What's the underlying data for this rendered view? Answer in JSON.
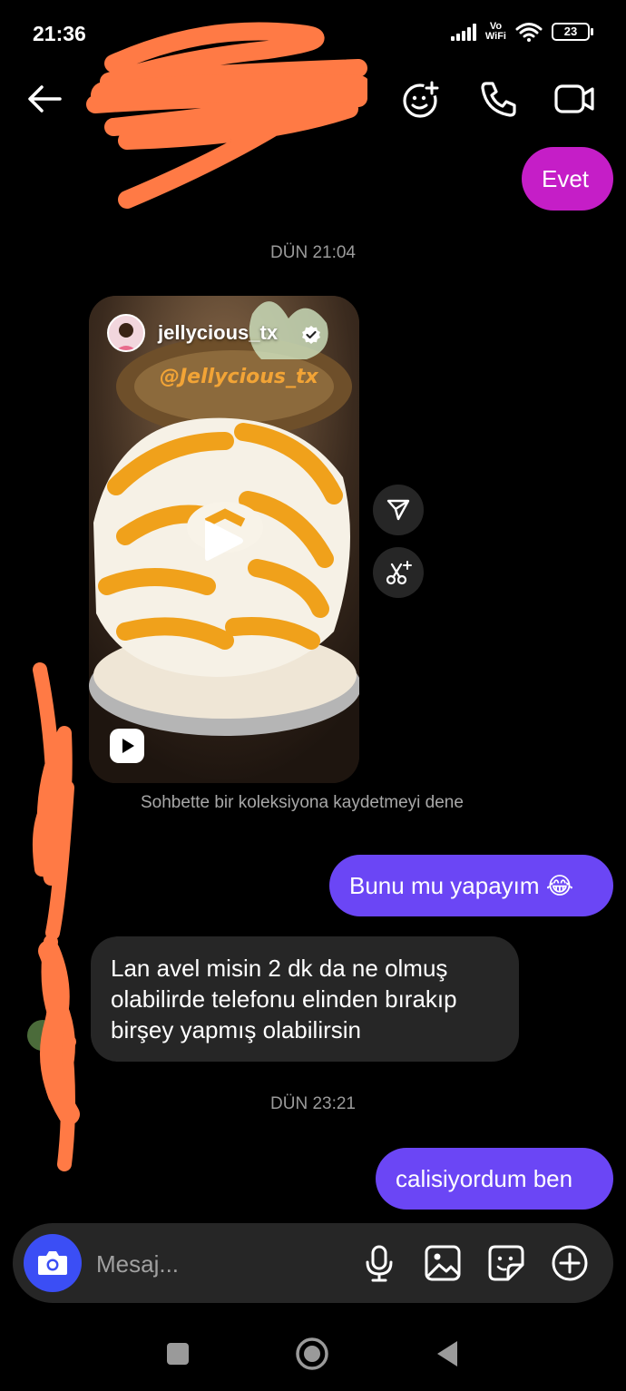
{
  "status_bar": {
    "time": "21:36",
    "network_label_top": "Vo",
    "network_label_bottom": "WiFi",
    "battery": "23"
  },
  "header": {
    "back_icon": "arrow-left-icon",
    "actions": [
      "add-effect-icon",
      "phone-icon",
      "video-camera-icon"
    ]
  },
  "messages": {
    "sent_evet": "Evet",
    "timestamp_1": "DÜN 21:04",
    "reel": {
      "username": "jellycious_tx",
      "watermark": "@Jellycious_tx"
    },
    "save_hint": "Sohbette bir koleksiyona kaydetmeyi dene",
    "sent_bunu": "Bunu mu yapayım 😂",
    "received_1": "Lan avel misin 2 dk da ne olmuş olabilirde telefonu elinden bırakıp birşey yapmış olabilirsin",
    "timestamp_2": "DÜN 23:21",
    "sent_calisiyordum": "calisiyordum ben"
  },
  "composer": {
    "placeholder": "Mesaj..."
  },
  "colors": {
    "background": "#000000",
    "sent_bubble": "#6b46f5",
    "sent_bubble_alt": "#c51ec7",
    "received_bubble": "#262626",
    "camera_button": "#3b4ef5",
    "redaction": "#ff7a45"
  }
}
